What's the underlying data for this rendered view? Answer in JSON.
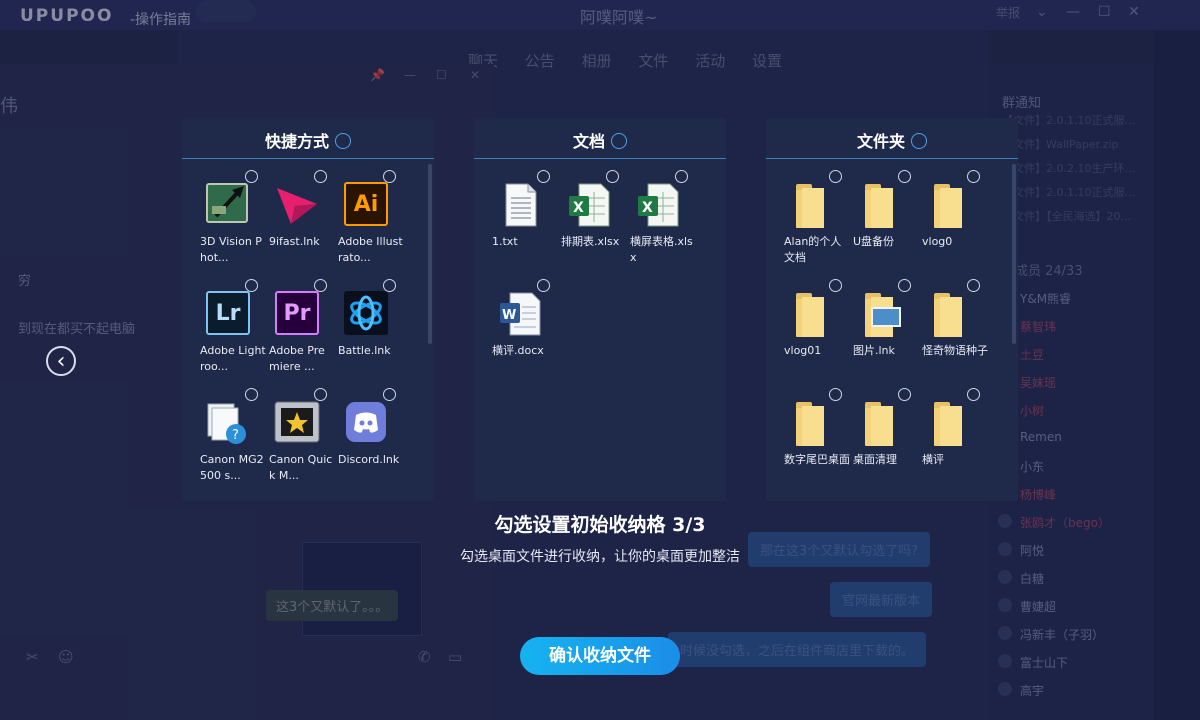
{
  "app": {
    "logo": "UPUPOO",
    "subtitle": "-操作指南",
    "window_title": "阿噗阿噗~",
    "report_link": "举报"
  },
  "background_chat": {
    "left_name": "伟",
    "msg_1": "穷",
    "msg_2": "到现在都买不起电脑",
    "bubble": "这3个又默认了。。。",
    "tabs": [
      "聊天",
      "公告",
      "相册",
      "文件",
      "活动",
      "设置"
    ],
    "bubbles_right": [
      "那在这3个又默认勾选了吗?",
      "官网最新版本",
      "时候没勾选，之后在组件商店里下载的。"
    ],
    "notice_title": "群通知",
    "notices": [
      "【文件】2.0.1.10正式服...",
      "【文件】WallPaper.zip",
      "【文件】2.0.2.10生产环...",
      "【文件】2.0.1.10正式服...",
      "【文件】【全民海选】20..."
    ],
    "members_title": "群成员 24/33",
    "members": [
      {
        "name": "Y&M熊睿",
        "color": "#8d94b8"
      },
      {
        "name": "蔡智玮",
        "color": "#b0485a"
      },
      {
        "name": "土豆",
        "color": "#b0485a"
      },
      {
        "name": "吴妹瑶",
        "color": "#b0485a"
      },
      {
        "name": "小树",
        "color": "#b0485a"
      },
      {
        "name": "Remen",
        "color": "#8d94b8"
      },
      {
        "name": "小东",
        "color": "#8d94b8"
      },
      {
        "name": "杨博峰",
        "color": "#b0485a"
      },
      {
        "name": "张鸥才（bego）",
        "color": "#b0485a"
      },
      {
        "name": "阿悦",
        "color": "#8d94b8"
      },
      {
        "name": "白糖",
        "color": "#8d94b8"
      },
      {
        "name": "曹婕超",
        "color": "#8d94b8"
      },
      {
        "name": "冯新丰（子羽）",
        "color": "#8d94b8"
      },
      {
        "name": "富士山下",
        "color": "#8d94b8"
      },
      {
        "name": "高宇",
        "color": "#8d94b8"
      }
    ]
  },
  "panels": [
    {
      "title": "快捷方式",
      "items": [
        {
          "label": "3D Vision Phot...",
          "icon": "3d-vision-icon"
        },
        {
          "label": "9ifast.lnk",
          "icon": "9ifast-icon"
        },
        {
          "label": "Adobe Illustrato...",
          "icon": "illustrator-icon"
        },
        {
          "label": "Adobe Lightroo...",
          "icon": "lightroom-icon"
        },
        {
          "label": "Adobe Premiere ...",
          "icon": "premiere-icon"
        },
        {
          "label": "Battle.lnk",
          "icon": "battlenet-icon"
        },
        {
          "label": "Canon MG2500 s...",
          "icon": "canon-help-icon"
        },
        {
          "label": "Canon Quick M...",
          "icon": "canon-quick-menu-icon"
        },
        {
          "label": "Discord.lnk",
          "icon": "discord-icon"
        }
      ]
    },
    {
      "title": "文档",
      "items": [
        {
          "label": "1.txt",
          "icon": "text-file-icon"
        },
        {
          "label": "排期表.xlsx",
          "icon": "excel-file-icon"
        },
        {
          "label": "横屏表格.xlsx",
          "icon": "excel-file-icon"
        },
        {
          "label": "横评.docx",
          "icon": "word-file-icon"
        }
      ]
    },
    {
      "title": "文件夹",
      "items": [
        {
          "label": "Alan的个人文档",
          "icon": "folder-icon"
        },
        {
          "label": "U盘备份",
          "icon": "folder-icon"
        },
        {
          "label": "vlog0",
          "icon": "folder-icon"
        },
        {
          "label": "vlog01",
          "icon": "folder-icon"
        },
        {
          "label": "图片.lnk",
          "icon": "picture-folder-icon"
        },
        {
          "label": "怪奇物语种子",
          "icon": "folder-icon"
        },
        {
          "label": "数字尾巴桌面",
          "icon": "folder-icon"
        },
        {
          "label": "桌面清理",
          "icon": "folder-icon"
        },
        {
          "label": "横评",
          "icon": "folder-icon"
        }
      ]
    }
  ],
  "guide": {
    "title": "勾选设置初始收纳格 3/3",
    "description": "勾选桌面文件进行收纳，让你的桌面更加整洁",
    "confirm_button": "确认收纳文件"
  },
  "colors": {
    "accent": "#1aa3ee",
    "panel_bg": "#1f2a4a",
    "panel_line": "#3f7fb8"
  }
}
